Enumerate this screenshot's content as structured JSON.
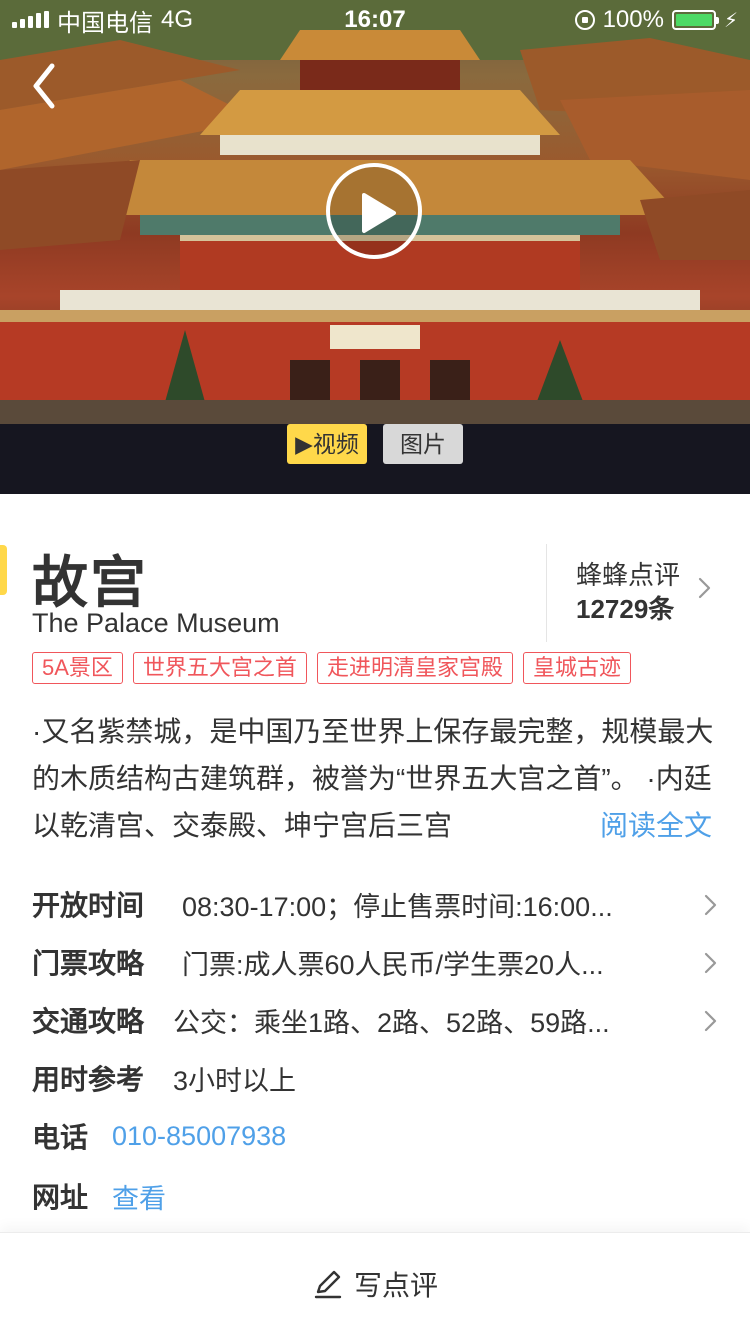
{
  "status_bar": {
    "carrier": "中国电信",
    "network": "4G",
    "time": "16:07",
    "battery": "100%",
    "battery_level": 1.0
  },
  "media_tabs": {
    "video": "视频",
    "photos": "图片"
  },
  "attraction": {
    "name_cn": "故宫",
    "name_en": "The Palace Museum",
    "review_source": "蜂蜂点评",
    "review_count": "12729条",
    "tags": [
      "5A景区",
      "世界五大宫之首",
      "走进明清皇家宫殿",
      "皇城古迹"
    ],
    "description": "·又名紫禁城，是中国乃至世界上保存最完整，规模最大的木质结构古建筑群，被誉为“世界五大宫之首”。 ·内廷以乾清宫、交泰殿、坤宁宫后三宫",
    "read_more": "阅读全文"
  },
  "info": {
    "hours_label": "开放时间",
    "hours_value": "08:30-17:00；停止售票时间:16:00...",
    "ticket_label": "门票攻略",
    "ticket_value": "门票:成人票60人民币/学生票20人...",
    "transport_label": "交通攻略",
    "transport_value": "公交：乘坐1路、2路、52路、59路...",
    "duration_label": "用时参考",
    "duration_value": "3小时以上",
    "phone_label": "电话",
    "phone_value": "010-85007938",
    "website_label": "网址",
    "website_value": "查看"
  },
  "bottom_bar": {
    "write_review": "写点评"
  },
  "colors": {
    "accent_yellow": "#ffd84a",
    "tag_red": "#f0565b",
    "link_blue": "#4fa0e8"
  },
  "icons": [
    "back-chevron-icon",
    "play-icon",
    "chevron-right-icon",
    "pencil-icon",
    "signal-icon",
    "lock-rotation-icon",
    "battery-icon",
    "charging-icon"
  ]
}
